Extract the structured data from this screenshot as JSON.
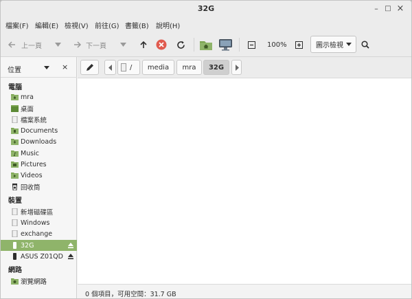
{
  "window": {
    "title": "32G",
    "minimize": "–",
    "maximize": "□",
    "close": "×"
  },
  "menu": [
    "檔案(F)",
    "編輯(E)",
    "檢視(V)",
    "前往(G)",
    "書籤(B)",
    "說明(H)"
  ],
  "toolbar": {
    "back_label": "上一頁",
    "forward_label": "下一頁",
    "zoom_level": "100%",
    "view_mode": "圖示檢視"
  },
  "sidebar": {
    "header": "位置",
    "close": "×",
    "sections": {
      "computer": "電腦",
      "devices": "裝置",
      "network": "網路"
    },
    "computer_items": [
      "mra",
      "桌面",
      "檔案系統",
      "Documents",
      "Downloads",
      "Music",
      "Pictures",
      "Videos",
      "回收筒"
    ],
    "device_items": [
      "新增磁碟區",
      "Windows",
      "exchange",
      "32G",
      "ASUS Z01QD"
    ],
    "network_items": [
      "瀏覽網路"
    ],
    "selected": "32G"
  },
  "pathbar": {
    "segments": [
      "/",
      "media",
      "mra",
      "32G"
    ],
    "active": "32G"
  },
  "status": {
    "text": "0 個項目，可用空間：31.7 GB"
  },
  "colors": {
    "accent": "#8fb46a",
    "folder": "#7aa34f"
  }
}
